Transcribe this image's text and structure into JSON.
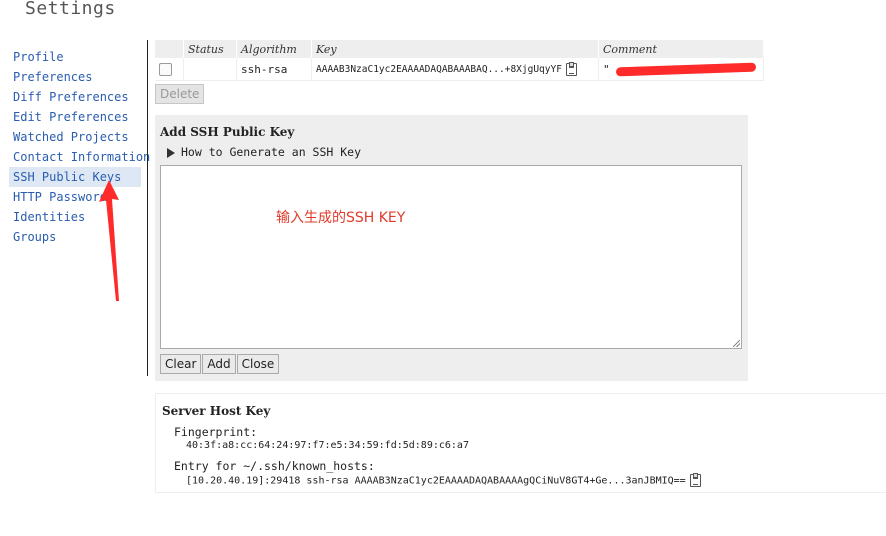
{
  "page": {
    "title": "Settings"
  },
  "sidebar": {
    "items": [
      {
        "label": "Profile"
      },
      {
        "label": "Preferences"
      },
      {
        "label": "Diff Preferences"
      },
      {
        "label": "Edit Preferences"
      },
      {
        "label": "Watched Projects"
      },
      {
        "label": "Contact Information"
      },
      {
        "label": "SSH Public Keys",
        "active": true
      },
      {
        "label": "HTTP Password"
      },
      {
        "label": "Identities"
      },
      {
        "label": "Groups"
      }
    ]
  },
  "keys_table": {
    "headers": {
      "status": "Status",
      "algorithm": "Algorithm",
      "key": "Key",
      "comment": "Comment"
    },
    "rows": [
      {
        "checked": false,
        "algorithm": "ssh-rsa",
        "key": "AAAAB3NzaC1yc2EAAAADAQABAAABAQ...+8XjgUqyYF",
        "comment": "\""
      }
    ],
    "delete_label": "Delete"
  },
  "add_panel": {
    "title": "Add SSH Public Key",
    "howto_label": "How to Generate an SSH Key",
    "annotation": "输入生成的SSH KEY",
    "clear_label": "Clear",
    "add_label": "Add",
    "close_label": "Close"
  },
  "server_host_key": {
    "title": "Server Host Key",
    "fingerprint_label": "Fingerprint:",
    "fingerprint": "40:3f:a8:cc:64:24:97:f7:e5:34:59:fd:5d:89:c6:a7",
    "known_hosts_label": "Entry for ~/.ssh/known_hosts:",
    "known_hosts": "[10.20.40.19]:29418 ssh-rsa AAAAB3NzaC1yc2EAAAADAQABAAAAgQCiNuV8GT4+Ge...3anJBMIQ=="
  },
  "colors": {
    "link": "#2a5db0",
    "annotation": "#e23a2a",
    "panel_bg": "#eeeeee"
  }
}
